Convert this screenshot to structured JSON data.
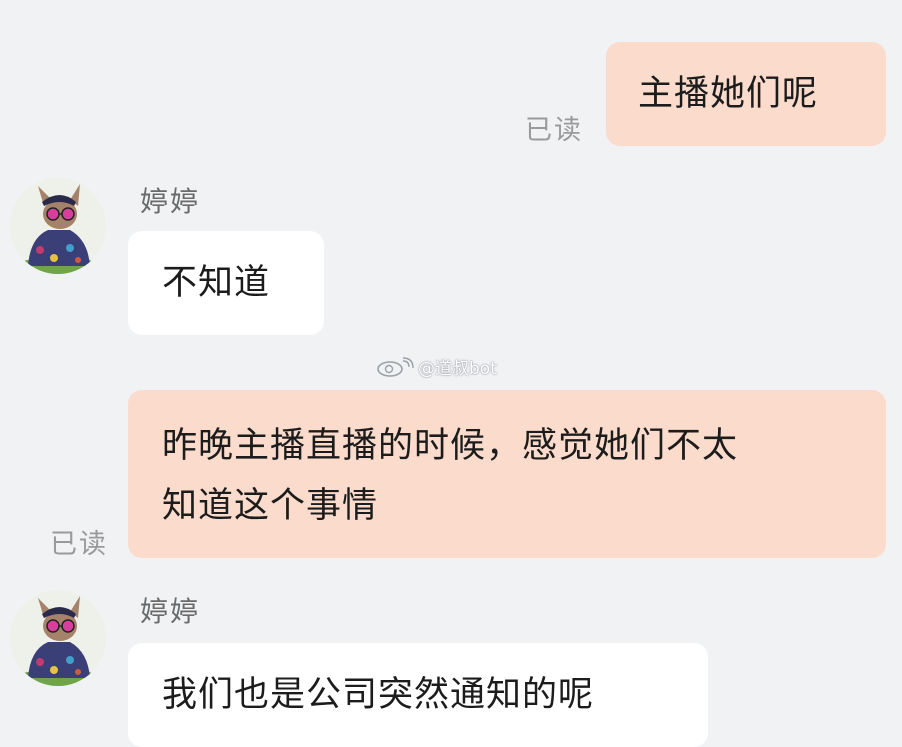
{
  "messages": [
    {
      "side": "out",
      "text": "主播她们呢",
      "status": "已读"
    },
    {
      "side": "in",
      "sender": "婷婷",
      "text": "不知道"
    },
    {
      "side": "out",
      "lines": [
        "昨晚主播直播的时候，感觉她们不太",
        "知道这个事情"
      ],
      "status": "已读"
    },
    {
      "side": "in",
      "sender": "婷婷",
      "text": "我们也是公司突然通知的呢"
    }
  ],
  "watermark": {
    "text": "@道叔bot"
  },
  "colors": {
    "background": "#f1f2f4",
    "outgoing_bubble": "#fbdbcb",
    "incoming_bubble": "#ffffff",
    "read_label": "#9a9a9a"
  }
}
